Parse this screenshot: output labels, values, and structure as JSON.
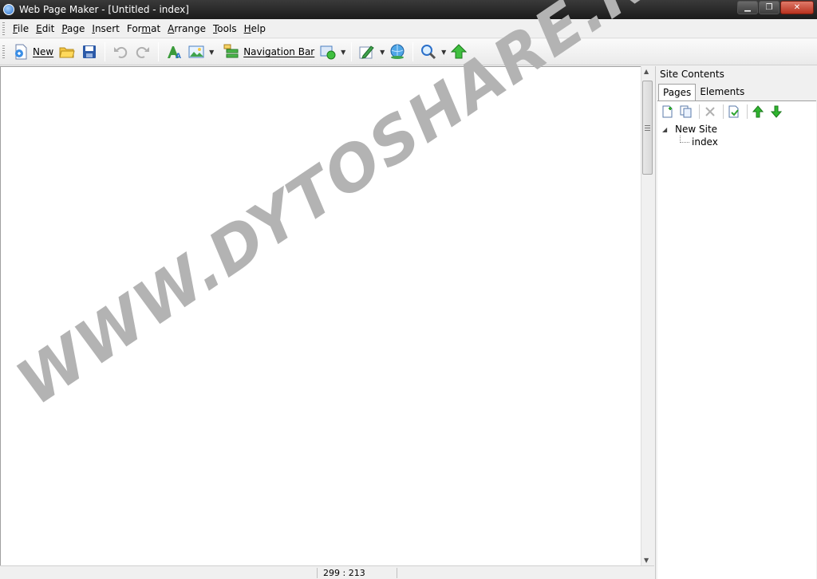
{
  "window": {
    "title": "Web Page Maker - [Untitled - index]",
    "controls": {
      "minimize": "▁",
      "restore": "❐",
      "close": "✕"
    }
  },
  "menubar": {
    "items": [
      {
        "label": "File",
        "underline": "F"
      },
      {
        "label": "Edit",
        "underline": "E"
      },
      {
        "label": "Page",
        "underline": "P"
      },
      {
        "label": "Insert",
        "underline": "I"
      },
      {
        "label": "Format",
        "underline": "m"
      },
      {
        "label": "Arrange",
        "underline": "A"
      },
      {
        "label": "Tools",
        "underline": "T"
      },
      {
        "label": "Help",
        "underline": "H"
      }
    ]
  },
  "toolbar": {
    "new_label": "New",
    "navbar_label": "Navigation Bar",
    "icons": [
      "new-page-icon",
      "open-folder-icon",
      "save-icon",
      "undo-icon",
      "redo-icon",
      "text-icon",
      "image-icon",
      "navigation-bar-icon",
      "shape-icon",
      "edit-icon",
      "publish-globe-icon",
      "zoom-icon",
      "upload-arrow-icon"
    ]
  },
  "editor": {
    "watermark": "WWW.DYTOSHARE.NET"
  },
  "statusbar": {
    "coordinates": "299 : 213"
  },
  "panel": {
    "title": "Site Contents",
    "tabs": [
      {
        "label": "Pages",
        "active": true
      },
      {
        "label": "Elements",
        "active": false
      }
    ],
    "tree": {
      "root": "New Site",
      "children": [
        "index"
      ]
    }
  },
  "colors": {
    "titlebar": "#1b1b1b",
    "close_button": "#b8321f",
    "watermark": "#b3b3b3",
    "green_arrow": "#2fb52f"
  }
}
